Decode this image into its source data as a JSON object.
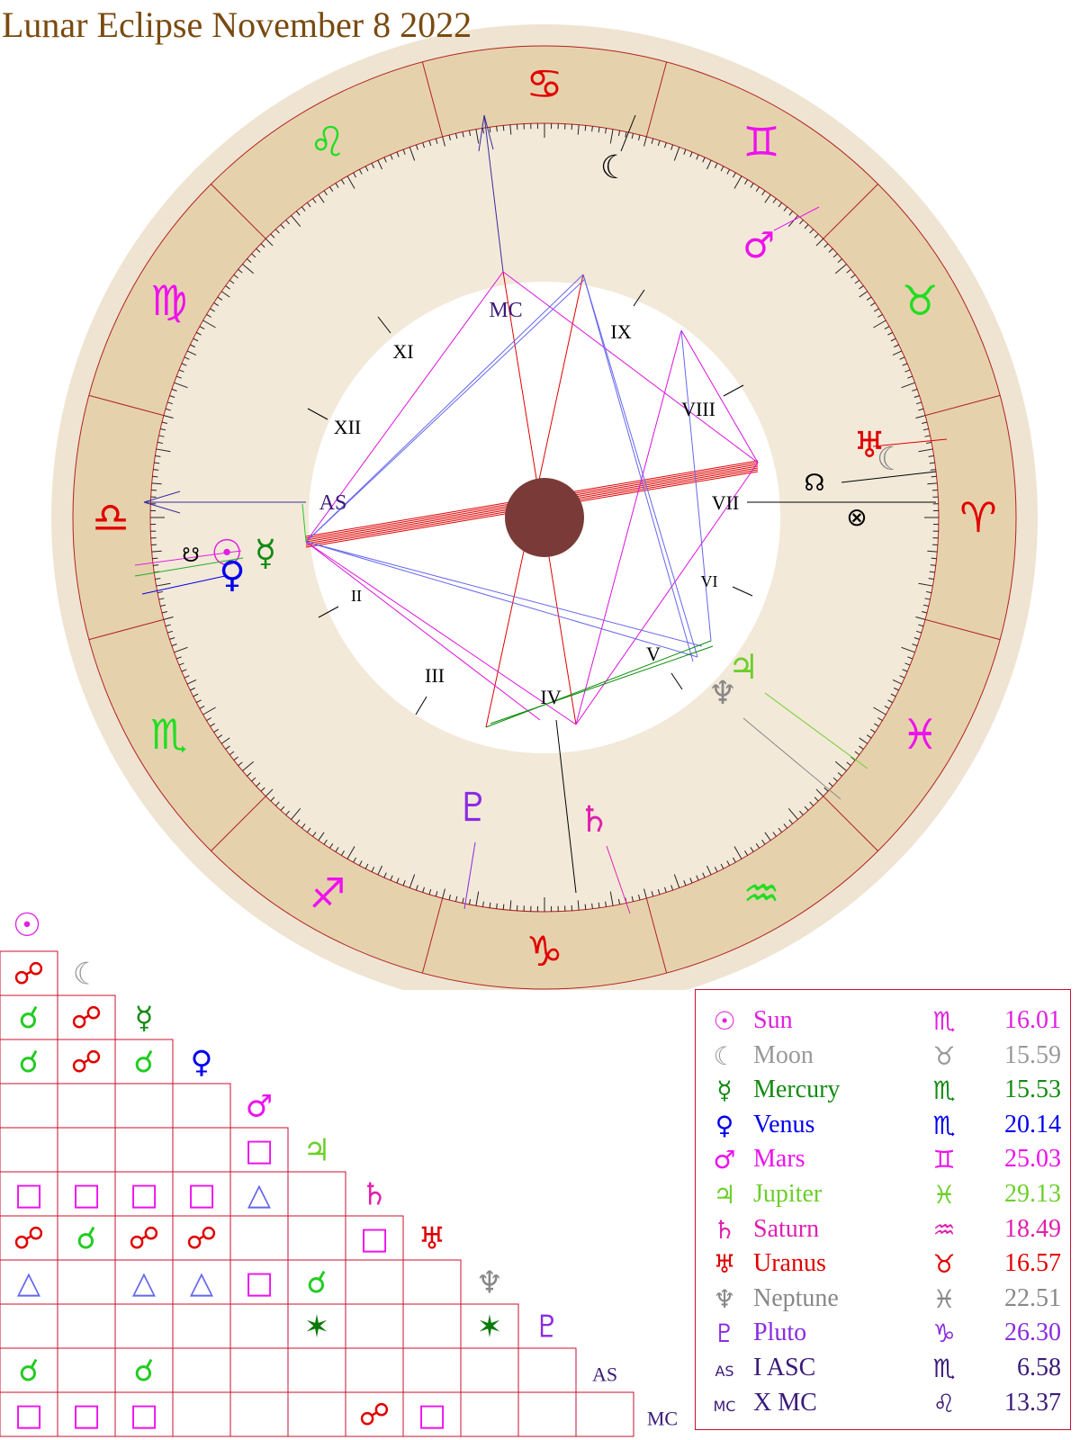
{
  "title": "Lunar Eclipse November 8 2022",
  "colors": {
    "outer_disc": "#efe4d1",
    "zodiac_band": "#e5d2ad",
    "inner_band": "#f3e9d9",
    "center_dot": "#7a3b38",
    "line_red": "#e00000",
    "frame_red": "#b22222"
  },
  "wheel": {
    "zodiac_signs": [
      {
        "name": "Leo",
        "glyph": "♌",
        "color": "#22dd22"
      },
      {
        "name": "Cancer",
        "glyph": "♋",
        "color": "#e00000"
      },
      {
        "name": "Gemini",
        "glyph": "♊",
        "color": "#ee11ee"
      },
      {
        "name": "Taurus",
        "glyph": "♉",
        "color": "#22dd22"
      },
      {
        "name": "Aries",
        "glyph": "♈",
        "color": "#e00000"
      },
      {
        "name": "Pisces",
        "glyph": "♓",
        "color": "#ee11ee"
      },
      {
        "name": "Aquarius",
        "glyph": "♒",
        "color": "#22dd22"
      },
      {
        "name": "Capricorn",
        "glyph": "♑",
        "color": "#e00000"
      },
      {
        "name": "Sagittarius",
        "glyph": "♐",
        "color": "#ee11ee"
      },
      {
        "name": "Scorpio",
        "glyph": "♏",
        "color": "#22dd22"
      },
      {
        "name": "Libra",
        "glyph": "♎",
        "color": "#e00000"
      },
      {
        "name": "Virgo",
        "glyph": "♍",
        "color": "#ee11ee"
      }
    ],
    "houses": [
      "XI",
      "XII",
      "II",
      "III",
      "IV",
      "V",
      "VI",
      "VII",
      "VIII",
      "IX"
    ],
    "axis_labels": {
      "asc": "AS",
      "mc": "MC"
    },
    "node_glyphs": {
      "north": "☊",
      "south": "☋",
      "fortune": "⊗"
    },
    "planets": [
      {
        "name": "Sun",
        "glyph": "☉",
        "color": "#e020e0"
      },
      {
        "name": "Moon",
        "glyph": "☾",
        "color": "#000000"
      },
      {
        "name": "Mercury",
        "glyph": "☿",
        "color": "#138a13"
      },
      {
        "name": "Venus",
        "glyph": "♀",
        "color": "#0000ee"
      },
      {
        "name": "Mars",
        "glyph": "♂",
        "color": "#ee11ee"
      },
      {
        "name": "Jupiter",
        "glyph": "♃",
        "color": "#6ccf2a"
      },
      {
        "name": "Saturn",
        "glyph": "♄",
        "color": "#e020b0"
      },
      {
        "name": "Uranus",
        "glyph": "♅",
        "color": "#e00000"
      },
      {
        "name": "Neptune",
        "glyph": "♆",
        "color": "#888888"
      },
      {
        "name": "Pluto",
        "glyph": "♇",
        "color": "#8a2be2"
      }
    ]
  },
  "aspect_grid": {
    "headers": [
      {
        "glyph": "☉",
        "color": "#e020e0"
      },
      {
        "glyph": "☾",
        "color": "#999999"
      },
      {
        "glyph": "☿",
        "color": "#138a13"
      },
      {
        "glyph": "♀",
        "color": "#0000ee"
      },
      {
        "glyph": "♂",
        "color": "#ee11ee"
      },
      {
        "glyph": "♃",
        "color": "#6ccf2a"
      },
      {
        "glyph": "♄",
        "color": "#e020b0"
      },
      {
        "glyph": "♅",
        "color": "#e00000"
      },
      {
        "glyph": "♆",
        "color": "#888888"
      },
      {
        "glyph": "♇",
        "color": "#8a2be2"
      },
      {
        "glyph": "AS",
        "color": "#3a1a7a"
      },
      {
        "glyph": "MC",
        "color": "#3a1a7a"
      }
    ],
    "aspect_glyphs": {
      "opp": {
        "glyph": "☍",
        "color": "#e00000"
      },
      "conj": {
        "glyph": "☌",
        "color": "#22cc22"
      },
      "sq": {
        "glyph": "□",
        "color": "#ee11ee"
      },
      "tri": {
        "glyph": "△",
        "color": "#6666ee"
      },
      "sxt": {
        "glyph": "✶",
        "color": "#0a7a0a"
      }
    },
    "rows": [
      [
        "opp"
      ],
      [
        "conj",
        "opp"
      ],
      [
        "conj",
        "opp",
        "conj"
      ],
      [
        "",
        "",
        "",
        ""
      ],
      [
        "",
        "",
        "",
        "",
        "sq"
      ],
      [
        "sq",
        "sq",
        "sq",
        "sq",
        "tri",
        ""
      ],
      [
        "opp",
        "conj",
        "opp",
        "opp",
        "",
        "",
        "sq"
      ],
      [
        "tri",
        "",
        "tri",
        "tri",
        "sq",
        "conj",
        "",
        ""
      ],
      [
        "",
        "",
        "",
        "",
        "",
        "sxt",
        "",
        "",
        "sxt"
      ],
      [
        "conj",
        "",
        "conj",
        "",
        "",
        "",
        "",
        "",
        "",
        ""
      ],
      [
        "sq",
        "sq",
        "sq",
        "",
        "",
        "",
        "opp",
        "sq",
        "",
        "",
        ""
      ]
    ]
  },
  "planet_table": [
    {
      "glyph": "☉",
      "name": "Sun",
      "sign": "♏",
      "degree": "16.01",
      "color": "#e020e0"
    },
    {
      "glyph": "☾",
      "name": "Moon",
      "sign": "♉",
      "degree": "15.59",
      "color": "#999999"
    },
    {
      "glyph": "☿",
      "name": "Mercury",
      "sign": "♏",
      "degree": "15.53",
      "color": "#138a13"
    },
    {
      "glyph": "♀",
      "name": "Venus",
      "sign": "♏",
      "degree": "20.14",
      "color": "#0000ee"
    },
    {
      "glyph": "♂",
      "name": "Mars",
      "sign": "♊",
      "degree": "25.03",
      "color": "#ee11ee"
    },
    {
      "glyph": "♃",
      "name": "Jupiter",
      "sign": "♓",
      "degree": "29.13",
      "color": "#6ccf2a"
    },
    {
      "glyph": "♄",
      "name": "Saturn",
      "sign": "♒",
      "degree": "18.49",
      "color": "#e020b0"
    },
    {
      "glyph": "♅",
      "name": "Uranus",
      "sign": "♉",
      "degree": "16.57",
      "color": "#e00000"
    },
    {
      "glyph": "♆",
      "name": "Neptune",
      "sign": "♓",
      "degree": "22.51",
      "color": "#888888"
    },
    {
      "glyph": "♇",
      "name": "Pluto",
      "sign": "♑",
      "degree": "26.30",
      "color": "#8a2be2"
    },
    {
      "glyph": "AS",
      "name": "I ASC",
      "sign": "♏",
      "degree": "6.58",
      "color": "#3a1a7a"
    },
    {
      "glyph": "MC",
      "name": "X MC",
      "sign": "♌",
      "degree": "13.37",
      "color": "#3a1a7a"
    }
  ]
}
